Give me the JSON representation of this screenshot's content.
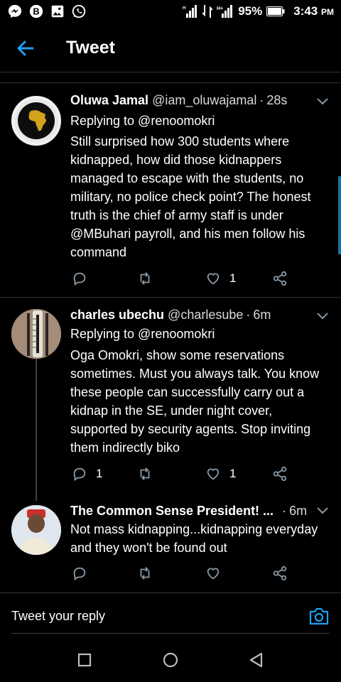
{
  "status_bar": {
    "notification_icons": [
      "messenger-icon",
      "b-circle-icon",
      "gallery-icon",
      "whatsapp-icon"
    ],
    "signal_icons": [
      "signal-bars-icon",
      "data-transfer-icon",
      "h-plus-signal-icon"
    ],
    "battery": "95%",
    "time": "3:43",
    "time_suffix": "PM"
  },
  "header": {
    "title": "Tweet"
  },
  "tweets": [
    {
      "name": "Oluwa Jamal",
      "handle": "@iam_oluwajamal",
      "time": "28s",
      "reply_label": "Replying to @renoomokri",
      "text": "Still surprised how 300 students where kidnapped, how did those kidnappers managed to escape with the students, no military, no police check point?  The honest truth is the chief of army staff is under @MBuhari payroll, and his men follow his command",
      "replies": "",
      "retweets": "",
      "likes": "1"
    },
    {
      "name": "charles ubechu",
      "handle": "@charlesube",
      "time": "6m",
      "reply_label": "Replying to @renoomokri",
      "text": "Oga Omokri, show some reservations sometimes.  Must you always talk. You know these people can successfully carry out a kidnap in the SE, under  night cover, supported by security agents.  Stop inviting them indirectly biko",
      "replies": "1",
      "retweets": "",
      "likes": "1"
    },
    {
      "name": "The Common Sense President! ...",
      "handle": "",
      "time": "6m",
      "reply_label": "",
      "text": "Not mass kidnapping...kidnapping everyday and they won't be found out",
      "replies": "",
      "retweets": "",
      "likes": ""
    }
  ],
  "reply_bar": {
    "placeholder": "Tweet your reply"
  },
  "colors": {
    "accent": "#1da1f2",
    "background": "#000000",
    "divider": "#2f3336",
    "icon_grey": "#8899a6"
  }
}
